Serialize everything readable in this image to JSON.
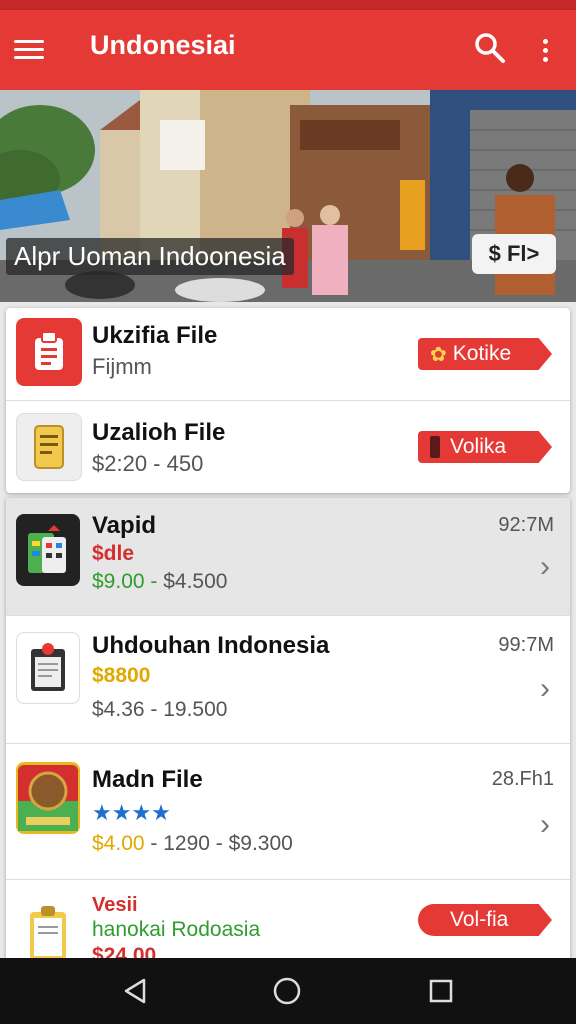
{
  "app": {
    "title": "Undonesiai"
  },
  "colors": {
    "primary": "#e53935",
    "status": "#c62828",
    "gold": "#e0a800",
    "green": "#2e9d2e"
  },
  "icons": {
    "menu": "menu-icon",
    "search": "search-icon",
    "more": "more-vert-icon"
  },
  "hero": {
    "caption": "Alpr Uoman Indoonesia",
    "button_label": "$ Fl>"
  },
  "featured": [
    {
      "title": "Ukzifia File",
      "subtitle": "Fijmm",
      "button": "Kotike",
      "button_icon": "flower-icon"
    },
    {
      "title": "Uzalioh File",
      "subtitle": "$2:20 - 450",
      "button": "Volika",
      "button_icon": "phone-icon"
    }
  ],
  "list": [
    {
      "title": "Vapid",
      "size": "92:7M",
      "line1": "$dle",
      "line2a": "$9.00",
      "line2sep": " - ",
      "line2b": "$4.500"
    },
    {
      "title": "Uhdouhan Indonesia",
      "size": "99:7M",
      "line1": "$8800",
      "line2": "$4.36 - 19.500"
    },
    {
      "title": "Madn File",
      "size": "28.Fh1",
      "stars": "★★★★",
      "line2a": "$4.00",
      "line2b": " - 1290 - $9.300"
    },
    {
      "title": "Vesii",
      "subtitle": "hanokai Rodoasia",
      "partial": "$24.00",
      "button": "Vol-fia"
    }
  ],
  "nav": {
    "back": "back-icon",
    "home": "home-icon",
    "recents": "recents-icon"
  }
}
